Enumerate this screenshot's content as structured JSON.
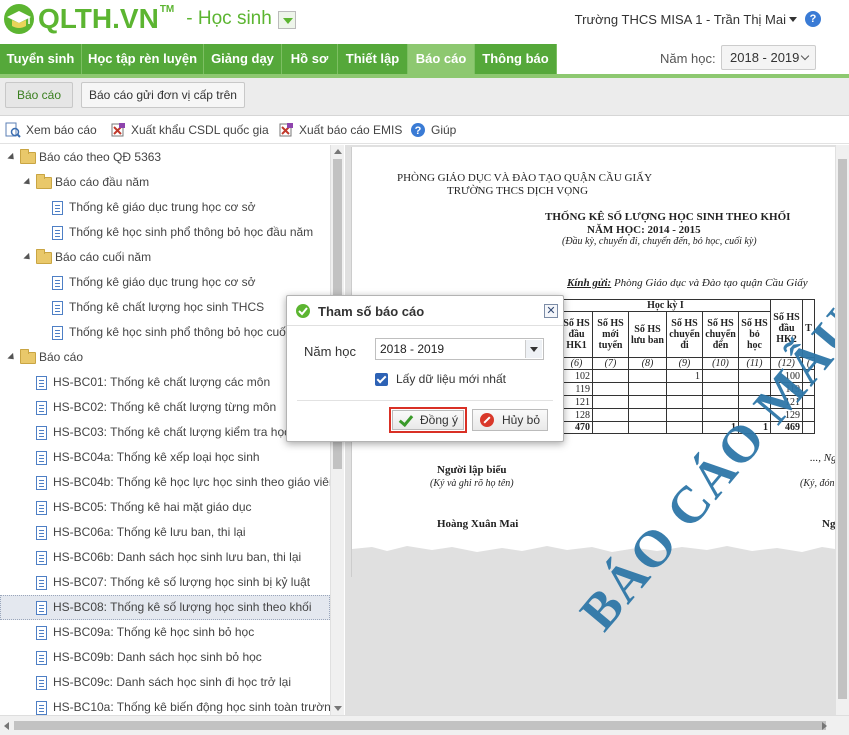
{
  "app": {
    "logo_text": "QLTH.VN",
    "logo_tm": "TM",
    "role": "- Học sinh",
    "user": "Trường THCS MISA 1 - Trần Thị Mai",
    "help_glyph": "?"
  },
  "nav": {
    "items": [
      "Tuyển sinh",
      "Học tập rèn luyện",
      "Giảng dạy",
      "Hồ sơ",
      "Thiết lập",
      "Báo cáo",
      "Thông báo"
    ],
    "active_index": 5,
    "year_label": "Năm học:",
    "year_value": "2018 - 2019"
  },
  "subtabs": [
    "Báo cáo",
    "Báo cáo gửi đơn vị cấp trên"
  ],
  "toolbar": {
    "view": "Xem báo cáo",
    "export_csdl": "Xuất khẩu CSDL quốc gia",
    "export_emis": "Xuất báo cáo EMIS",
    "help": "Giúp"
  },
  "tree": {
    "root1": "Báo cáo theo QĐ 5363",
    "group1": "Báo cáo đầu năm",
    "group1_items": [
      "Thống kê giáo dục trung học cơ sở",
      "Thống kê học sinh phổ thông bỏ học đầu năm"
    ],
    "group2": "Báo cáo cuối năm",
    "group2_items": [
      "Thống kê giáo dục trung học cơ sở",
      "Thống kê chất lượng học sinh THCS",
      "Thống kê học sinh phổ thông bỏ học cuối"
    ],
    "root2": "Báo cáo",
    "reports": [
      "HS-BC01: Thống kê chất lượng các môn",
      "HS-BC02: Thống kê chất lượng từng môn",
      "HS-BC03: Thống kê chất lượng kiểm tra học",
      "HS-BC04a: Thống kê xếp loại học sinh",
      "HS-BC04b: Thống kê học lực học sinh theo giáo viên",
      "HS-BC05: Thống kê hai mặt giáo dục",
      "HS-BC06a: Thống kê lưu ban, thi lại",
      "HS-BC06b: Danh sách học sinh lưu ban, thi lại",
      "HS-BC07: Thống kê số lượng học sinh bị kỷ luật",
      "HS-BC08: Thống kê số lượng học sinh theo khối",
      "HS-BC09a: Thống kê học sinh bỏ học",
      "HS-BC09b: Danh sách học sinh bỏ học",
      "HS-BC09c: Danh sách học sinh đi học trở lại",
      "HS-BC10a: Thống kê biến động học sinh toàn trường"
    ],
    "selected_index": 9
  },
  "report": {
    "org1": "PHÒNG GIÁO DỤC VÀ ĐÀO TẠO QUẬN CẦU GIẤY",
    "org2": "TRƯỜNG THCS DỊCH VỌNG",
    "title": "THỐNG KÊ SỐ LƯỢNG HỌC SINH THEO KHỐI",
    "year": "NĂM HỌC: 2014 - 2015",
    "note": "(Đầu kỳ, chuyển đi, chuyển đến, bỏ học, cuối kỳ)",
    "kg_label": "Kính gửi:",
    "kg_value": "Phòng Giáo dục và Đào tạo quận Cầu Giấy",
    "hk1": "Học kỳ I",
    "cols": [
      "Số HS đầu HK1",
      "Số HS mới tuyển",
      "Số HS lưu ban",
      "Số HS chuyển đi",
      "Số HS chuyển đến",
      "Số HS bỏ học",
      "Số HS đầu HK2",
      "T"
    ],
    "col_nums": [
      "(6)",
      "(7)",
      "(8)",
      "(9)",
      "(10)",
      "(11)",
      "(12)",
      "("
    ],
    "rows": [
      [
        "102",
        "",
        "",
        "1",
        "",
        "",
        "100",
        ""
      ],
      [
        "119",
        "",
        "",
        "",
        "",
        "",
        "119",
        ""
      ],
      [
        "121",
        "",
        "",
        "",
        "",
        "",
        "121",
        ""
      ],
      [
        "128",
        "",
        "",
        "",
        "",
        "",
        "129",
        ""
      ]
    ],
    "total": [
      "470",
      "",
      "",
      "",
      "1",
      "1",
      "469",
      ""
    ],
    "sig_left": "Người lập biểu",
    "sig_left_sub": "(Ký và ghi rõ họ tên)",
    "sig_right": "..., Ng",
    "sig_right_sub": "(Ký, đón",
    "sig_left_name": "Hoàng Xuân Mai",
    "sig_right_name": "Ng",
    "watermark": "BÁO CÁO MẪU"
  },
  "dialog": {
    "title": "Tham số báo cáo",
    "close": "✕",
    "year_label": "Năm học",
    "year_value": "2018 - 2019",
    "checkbox_label": "Lấy dữ liệu mới nhất",
    "checkbox_checked": true,
    "ok": "Đồng ý",
    "cancel": "Hủy bỏ"
  },
  "colors": {
    "brand_green": "#5cb531",
    "nav_green": "#55a83a",
    "nav_active": "#8dc870",
    "watermark_blue": "#2e77a8",
    "highlight_red": "#d93025"
  }
}
